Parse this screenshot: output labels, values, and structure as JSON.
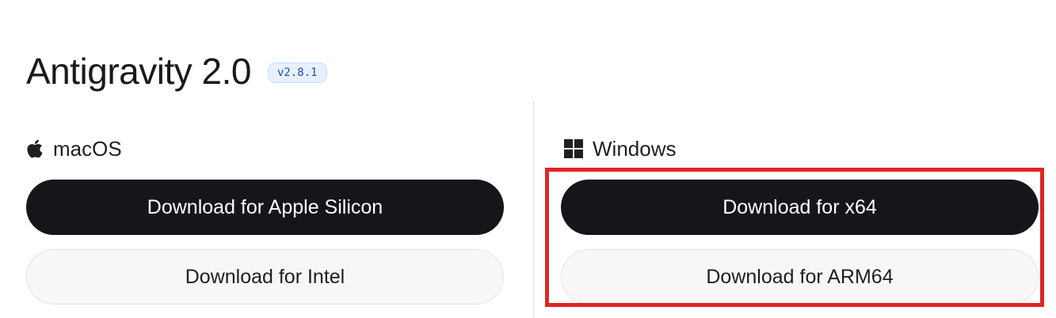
{
  "app": {
    "title": "Antigravity 2.0",
    "version": "v2.8.1"
  },
  "platforms": {
    "macos": {
      "label": "macOS",
      "icon": "apple-icon",
      "primary_button": "Download for Apple Silicon",
      "secondary_button": "Download for Intel"
    },
    "windows": {
      "label": "Windows",
      "icon": "windows-icon",
      "primary_button": "Download for x64",
      "secondary_button": "Download for ARM64"
    }
  },
  "highlight": {
    "target": "windows-download-buttons",
    "color": "#e02424"
  },
  "colors": {
    "primary_button_bg": "#16161a",
    "secondary_button_bg": "#f7f7f8",
    "badge_bg": "#e8f0fe",
    "badge_text": "#1a4fb3"
  }
}
